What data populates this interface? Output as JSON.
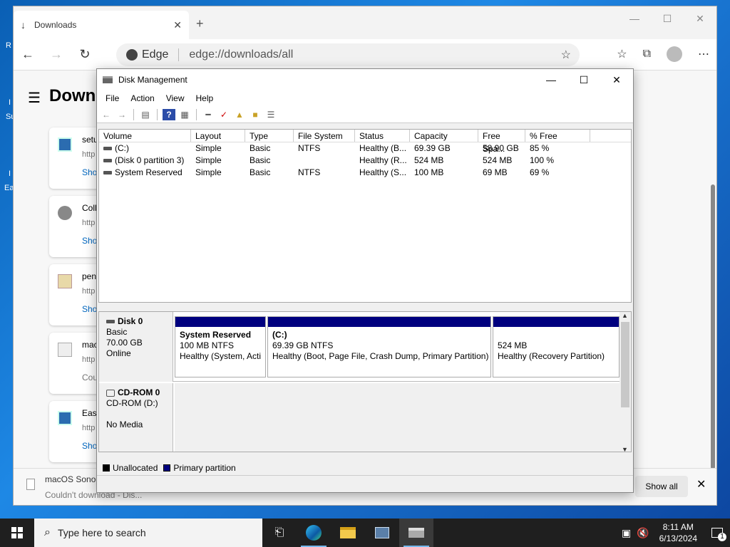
{
  "desktop": {
    "icon_texts": [
      "R",
      "I",
      "Su",
      "I",
      "Ea"
    ]
  },
  "edge": {
    "tab_title": "Downloads",
    "new_tab": "+",
    "address_brand": "Edge",
    "address_url": "edge://downloads/all",
    "page_title": "Downlo",
    "cards": [
      {
        "name": "setu",
        "url": "http",
        "link": "Sho"
      },
      {
        "name": "Coll",
        "url": "http",
        "link": "Sho"
      },
      {
        "name": "pen",
        "url": "http",
        "link": "Sho"
      },
      {
        "name": "mac",
        "url": "http",
        "link": "Cou"
      },
      {
        "name": "Eas",
        "url": "http",
        "link": "Sho"
      }
    ],
    "download_bar": {
      "file": "macOS Sonon",
      "error": "Couldn't download - Dis...",
      "show_all": "Show all"
    }
  },
  "dm": {
    "title": "Disk Management",
    "menu": [
      "File",
      "Action",
      "View",
      "Help"
    ],
    "columns": [
      "Volume",
      "Layout",
      "Type",
      "File System",
      "Status",
      "Capacity",
      "Free Spa...",
      "% Free"
    ],
    "volumes": [
      {
        "volume": "(C:)",
        "layout": "Simple",
        "type": "Basic",
        "fs": "NTFS",
        "status": "Healthy (B...",
        "capacity": "69.39 GB",
        "free": "58.90 GB",
        "pct": "85 %"
      },
      {
        "volume": "(Disk 0 partition 3)",
        "layout": "Simple",
        "type": "Basic",
        "fs": "",
        "status": "Healthy (R...",
        "capacity": "524 MB",
        "free": "524 MB",
        "pct": "100 %"
      },
      {
        "volume": "System Reserved",
        "layout": "Simple",
        "type": "Basic",
        "fs": "NTFS",
        "status": "Healthy (S...",
        "capacity": "100 MB",
        "free": "69 MB",
        "pct": "69 %"
      }
    ],
    "disk0": {
      "name": "Disk 0",
      "kind": "Basic",
      "size": "70.00 GB",
      "state": "Online",
      "partitions": [
        {
          "title": "System Reserved",
          "size": "100 MB NTFS",
          "status": "Healthy (System, Acti"
        },
        {
          "title": "(C:)",
          "size": "69.39 GB NTFS",
          "status": "Healthy (Boot, Page File, Crash Dump, Primary Partition)"
        },
        {
          "title": "",
          "size": "524 MB",
          "status": "Healthy (Recovery Partition)"
        }
      ]
    },
    "cdrom": {
      "name": "CD-ROM 0",
      "drive": "CD-ROM (D:)",
      "media": "No Media"
    },
    "legend": [
      {
        "label": "Unallocated",
        "color": "#000000"
      },
      {
        "label": "Primary partition",
        "color": "#00007f"
      }
    ]
  },
  "taskbar": {
    "search_placeholder": "Type here to search",
    "time": "8:11 AM",
    "date": "6/13/2024",
    "notif_count": "1"
  }
}
